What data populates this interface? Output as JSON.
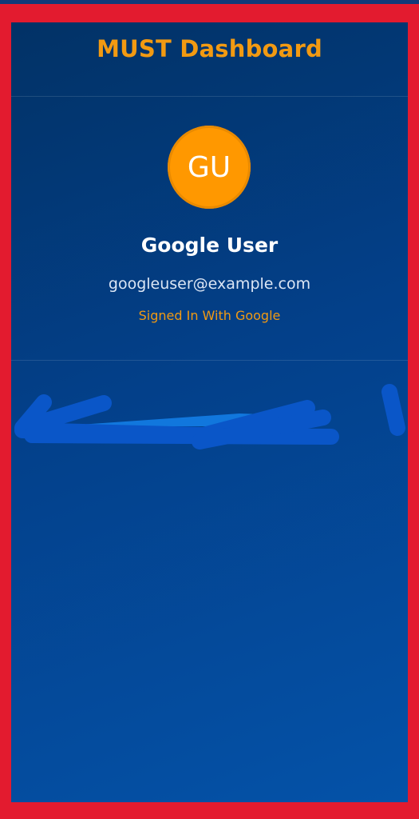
{
  "header": {
    "title": "MUST Dashboard"
  },
  "profile": {
    "avatar_initials": "GU",
    "name": "Google User",
    "email": "googleuser@example.com",
    "status": "Signed In With Google"
  },
  "colors": {
    "accent": "#f29a12",
    "avatar": "#ff9800",
    "panel": "#03408a",
    "frame": "#e31b2f",
    "scribble": "#0a56c8"
  }
}
